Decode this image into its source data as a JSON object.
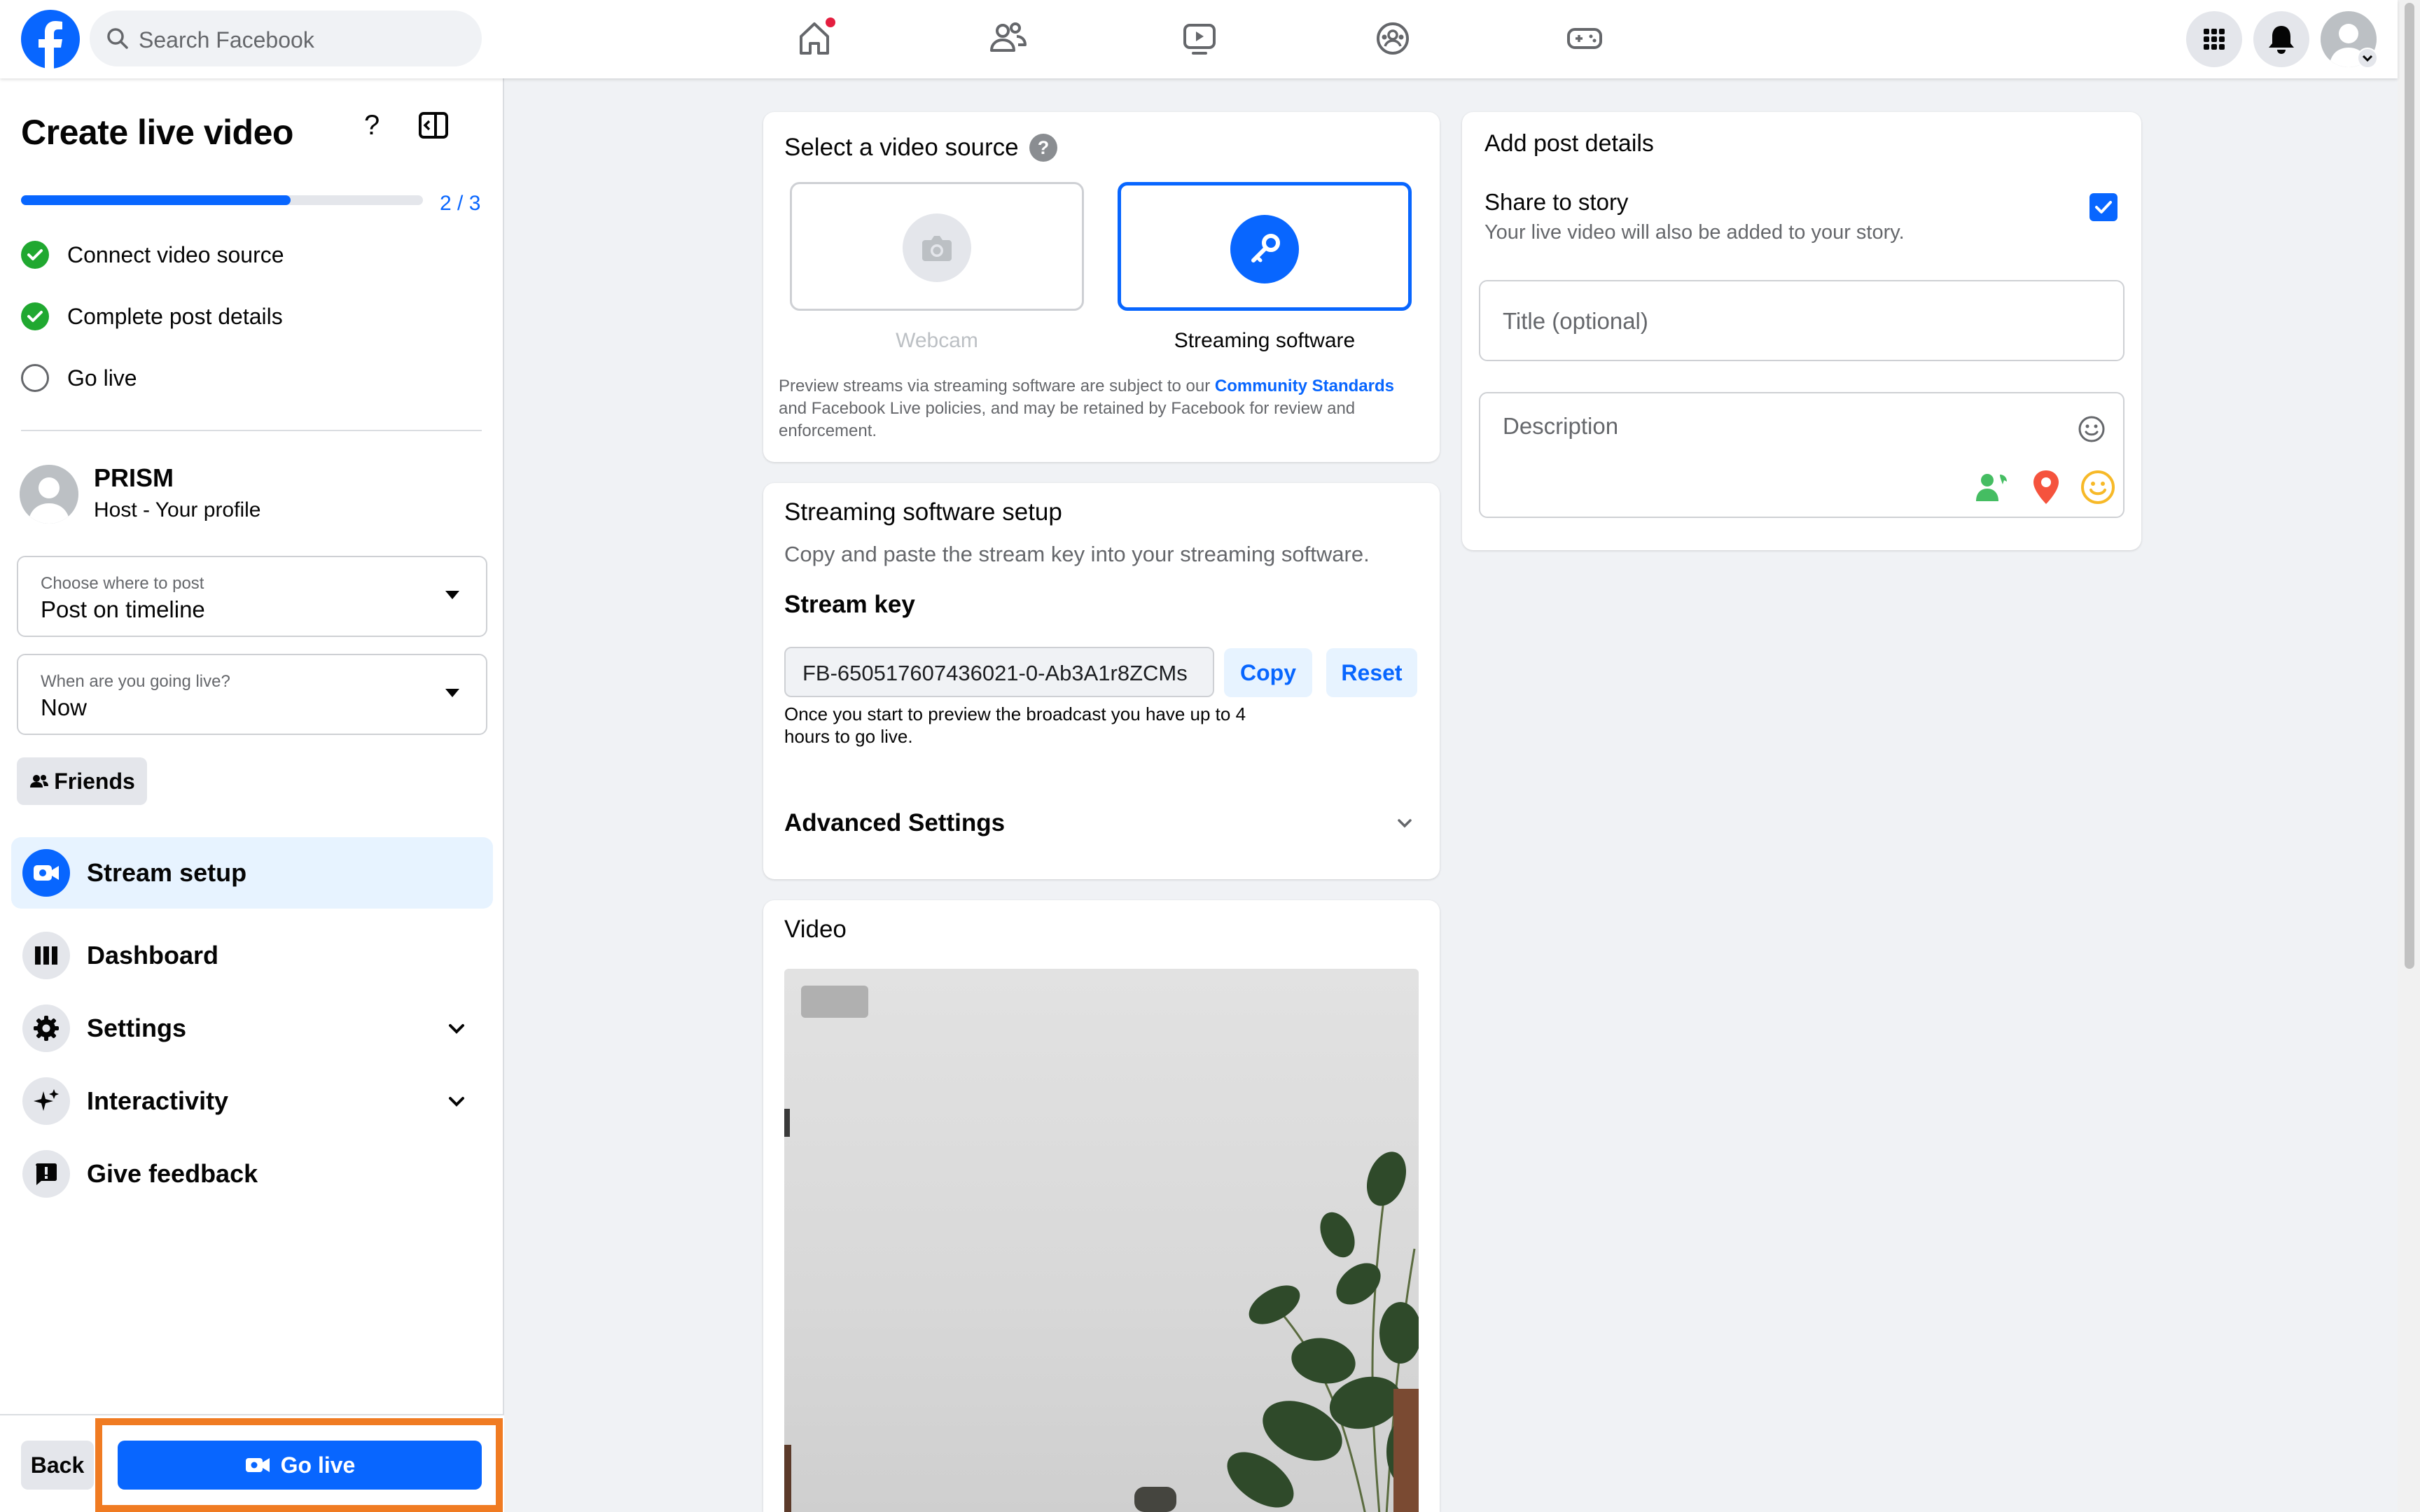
{
  "topbar": {
    "search_placeholder": "Search Facebook",
    "nav": [
      "home",
      "friends",
      "watch",
      "groups",
      "gaming"
    ]
  },
  "left": {
    "title": "Create live video",
    "progress": {
      "fraction": 0.67,
      "label": "2 / 3"
    },
    "steps": [
      {
        "label": "Connect video source",
        "done": true
      },
      {
        "label": "Complete post details",
        "done": true
      },
      {
        "label": "Go live",
        "done": false
      }
    ],
    "profile": {
      "name": "PRISM",
      "role": "Host - Your profile"
    },
    "where_dropdown": {
      "label": "Choose where to post",
      "value": "Post on timeline"
    },
    "when_dropdown": {
      "label": "When are you going live?",
      "value": "Now"
    },
    "audience": "Friends",
    "menu": [
      {
        "label": "Stream setup",
        "active": true
      },
      {
        "label": "Dashboard"
      },
      {
        "label": "Settings",
        "expandable": true
      },
      {
        "label": "Interactivity",
        "expandable": true
      },
      {
        "label": "Give feedback"
      }
    ],
    "back_label": "Back",
    "golive_label": "Go live"
  },
  "source": {
    "title": "Select a video source",
    "webcam_label": "Webcam",
    "software_label": "Streaming software",
    "notice_pre": "Preview streams via streaming software are subject to our ",
    "notice_link": "Community Standards",
    "notice_post": " and Facebook Live policies, and may be retained by Facebook for review and enforcement."
  },
  "setup": {
    "title": "Streaming software setup",
    "subtitle": "Copy and paste the stream key into your streaming software.",
    "key_label": "Stream key",
    "key_value": "FB-650517607436021-0-Ab3A1r8ZCMs",
    "copy_label": "Copy",
    "reset_label": "Reset",
    "key_note": "Once you start to preview the broadcast you have up to 4 hours to go live.",
    "advanced_label": "Advanced Settings"
  },
  "video": {
    "title": "Video"
  },
  "post": {
    "title": "Add post details",
    "share_title": "Share to story",
    "share_sub": "Your live video will also be added to your story.",
    "share_checked": true,
    "title_placeholder": "Title (optional)",
    "desc_placeholder": "Description"
  },
  "colors": {
    "brand": "#0866ff",
    "highlight": "#f07b22",
    "success": "#20a830"
  }
}
